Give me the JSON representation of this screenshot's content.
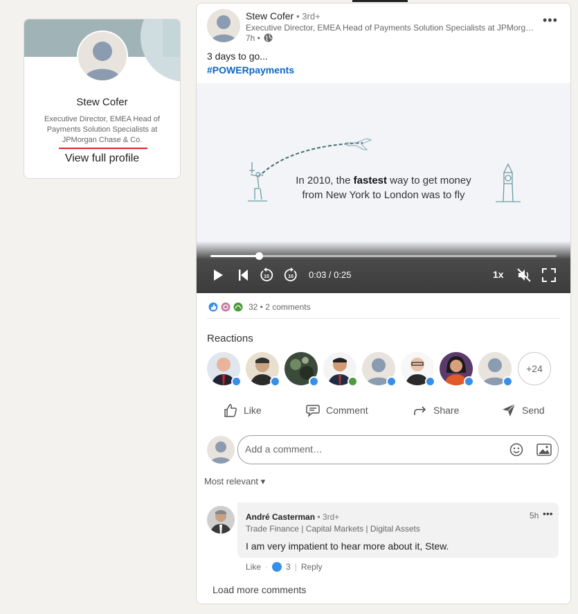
{
  "profile": {
    "name": "Stew Cofer",
    "headline": "Executive Director, EMEA Head of Payments Solution Specialists at JPMorgan Chase & Co.",
    "view_profile": "View full profile"
  },
  "post": {
    "author_name": "Stew Cofer",
    "author_degree": "• 3rd+",
    "author_headline": "Executive Director, EMEA Head of Payments Solution Specialists at JPMorgan Chase & Co.",
    "time": "7h •",
    "text": "3 days to go...",
    "hashtag": "#POWERpayments",
    "video": {
      "caption_pre": "In 2010, the ",
      "caption_bold": "fastest",
      "caption_post": " way to get money from New York to London was to fly",
      "time": "0:03 / 0:25",
      "progress": 0.14,
      "speed": "1x"
    },
    "reaction_summary": "32 • 2 comments",
    "reactions_title": "Reactions",
    "reactors_more": "+24",
    "actions": {
      "like": "Like",
      "comment": "Comment",
      "share": "Share",
      "send": "Send"
    },
    "comment_placeholder": "Add a comment…",
    "sort": "Most relevant"
  },
  "comment": {
    "name": "André Casterman",
    "degree": "• 3rd+",
    "headline": "Trade Finance | Capital Markets | Digital Assets",
    "time": "5h",
    "text": "I am very impatient to hear more about it, Stew.",
    "like": "Like",
    "likes_count": "3",
    "reply": "Reply"
  },
  "load_more": "Load more comments",
  "colors": {
    "link": "#0a66c2",
    "like_blue": "#378fe9",
    "underline_red": "#e02020"
  }
}
